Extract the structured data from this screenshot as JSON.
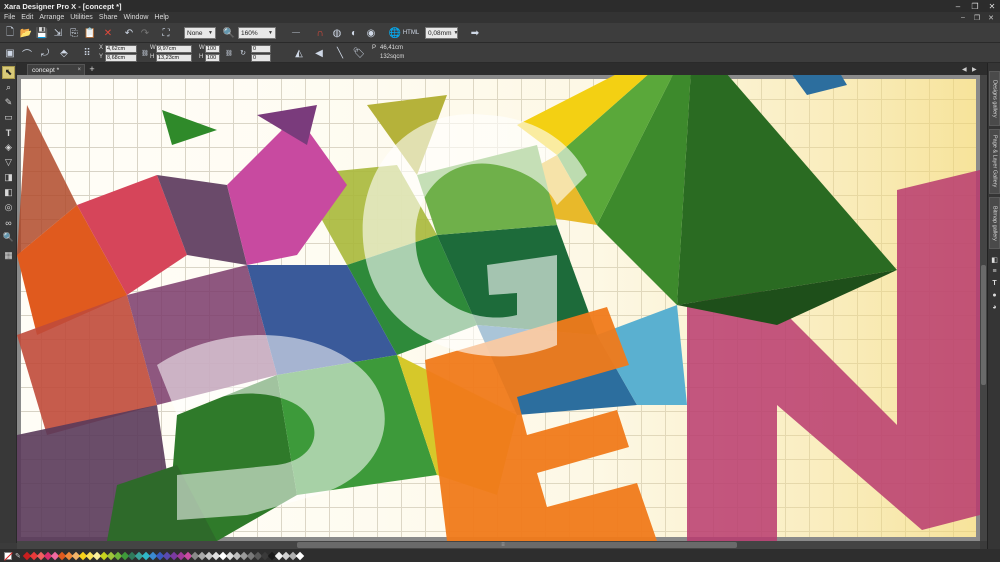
{
  "window": {
    "title": "Xara Designer Pro X - [concept *]",
    "minimize_icon": "minimize-icon",
    "maximize_icon": "maximize-icon",
    "close_icon": "close-icon"
  },
  "menu": {
    "items": [
      "File",
      "Edit",
      "Arrange",
      "Utilities",
      "Share",
      "Window",
      "Help"
    ]
  },
  "toolbar1": {
    "quality_value": "None",
    "zoom_value": "160%",
    "line_width_value": "0,08mm"
  },
  "toolbar2": {
    "x_label": "X",
    "x_value": "4,62cm",
    "y_label": "Y",
    "y_value": "8,68cm",
    "w_label": "W",
    "w_value": "9,97cm",
    "h_label": "H",
    "h_value": "13,23cm",
    "w_pct": "100",
    "h_pct": "100",
    "angle_value": "0",
    "skew_value": "0",
    "p_label": "P",
    "perimeter_value": "46,41cm",
    "area_value": "132sqcm"
  },
  "tab": {
    "label": "concept *",
    "close": "×",
    "add": "+"
  },
  "galleries": {
    "tabs": [
      "Designs gallery",
      "Page & Layer Gallery",
      "Bitmap gallery"
    ]
  },
  "artwork": {
    "letters": [
      "G",
      "E",
      "N",
      "S"
    ],
    "colors": {
      "background_grid": "#ffffff",
      "bg_warm": "#f7e8b0",
      "green": "#2f7a2a",
      "magenta": "#b8396e",
      "orange": "#f07a1a",
      "yellow": "#f3d013",
      "blue": "#2c6e9e",
      "purple": "#7a3b7c"
    }
  },
  "palette": {
    "colors": [
      "#c81e1e",
      "#e83a3a",
      "#f06060",
      "#d92f6c",
      "#ef6aa0",
      "#e05a1e",
      "#f08a3a",
      "#f2b46a",
      "#f7d21a",
      "#f9e25a",
      "#fbef9a",
      "#c6d41e",
      "#9fc43a",
      "#6fb43a",
      "#3f9a3a",
      "#2f7a5a",
      "#3aa39a",
      "#2fb7c7",
      "#3a8ad0",
      "#3a5ac0",
      "#5a4ab0",
      "#7a3aa0",
      "#a03a9a",
      "#c84aa0",
      "#8a8a8a",
      "#aaaaaa",
      "#c8c8c8",
      "#e0e0e0",
      "#ffffff",
      "#dcdcdc",
      "#bdbdbd",
      "#9a9a9a",
      "#7a7a7a",
      "#5a5a5a",
      "#3a3a3a",
      "#1a1a1a",
      "#f0f0f0",
      "#d0d0d0",
      "#b0b0b0",
      "#ffffff"
    ]
  }
}
